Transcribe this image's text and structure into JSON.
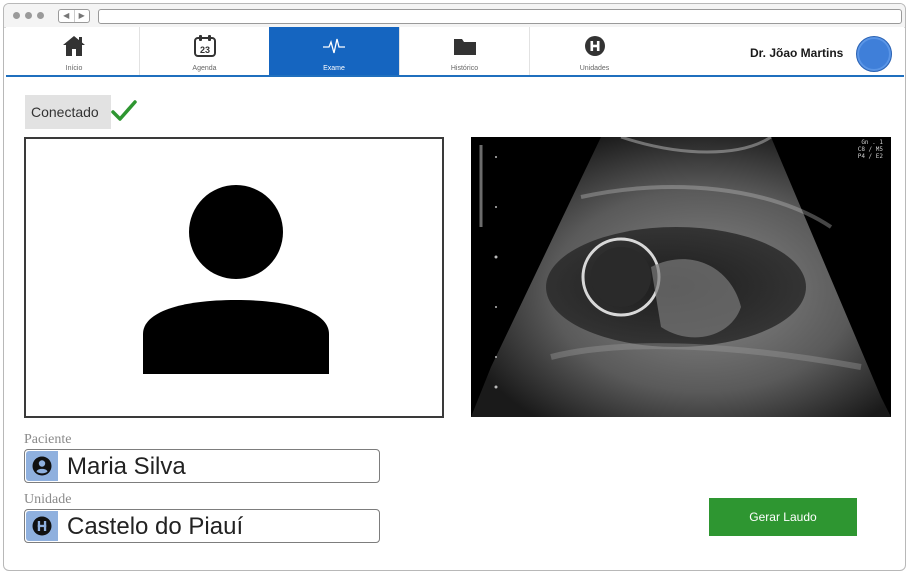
{
  "nav": {
    "items": [
      {
        "label": "Início",
        "icon": "home-icon"
      },
      {
        "label": "Agenda",
        "icon": "calendar-icon",
        "badge": "23"
      },
      {
        "label": "Exame",
        "icon": "heartbeat-icon",
        "active": true
      },
      {
        "label": "Histórico",
        "icon": "folder-icon"
      },
      {
        "label": "Unidades",
        "icon": "hospital-icon"
      }
    ],
    "active_color": "#1565c0"
  },
  "user": {
    "name": "Dr. Jõao Martins",
    "avatar_color": "#3f7fd9"
  },
  "status": {
    "text": "Conectado",
    "icon": "check-icon",
    "color": "#2e9631"
  },
  "video": {
    "placeholder_icon": "person-icon"
  },
  "ultrasound": {
    "readout": [
      "Gn . 1",
      "C8 / M5",
      "P4 / E2"
    ]
  },
  "patient": {
    "label": "Paciente",
    "value": "Maria Silva",
    "icon": "user-circle-icon"
  },
  "unit": {
    "label": "Unidade",
    "value": "Castelo do Piauí",
    "icon": "hospital-icon"
  },
  "actions": {
    "generate_report": "Gerar Laudo",
    "button_color": "#2e9631"
  }
}
